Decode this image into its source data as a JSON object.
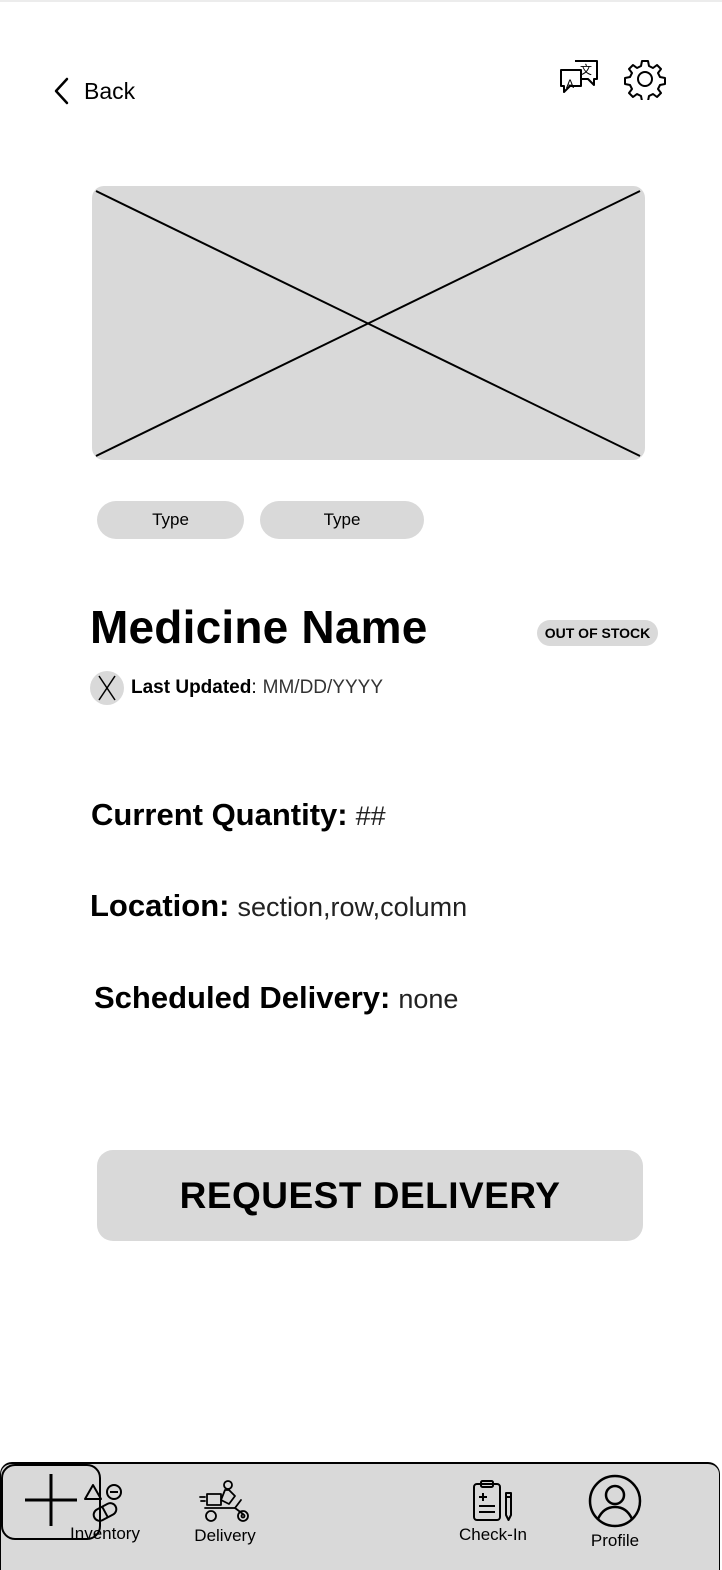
{
  "header": {
    "back_label": "Back",
    "icons": [
      "chevron-left-icon",
      "translate-icon",
      "gear-icon"
    ]
  },
  "product": {
    "types": [
      "Type",
      "Type"
    ],
    "name": "Medicine Name",
    "stock_badge": "OUT OF STOCK",
    "last_updated_label": "Last Updated",
    "last_updated_colon": ":",
    "last_updated_value": "MM/DD/YYYY"
  },
  "details": {
    "quantity_label": "Current Quantity:",
    "quantity_value": "##",
    "location_label": "Location:",
    "location_value": "section,row,column",
    "delivery_label": "Scheduled Delivery:",
    "delivery_value": "none"
  },
  "actions": {
    "request_label": "REQUEST DELIVERY"
  },
  "nav": {
    "inventory": "Inventory",
    "delivery": "Delivery",
    "checkin": "Check-In",
    "profile": "Profile"
  },
  "colors": {
    "placeholder": "#d9d9d9",
    "background": "#ffffff",
    "text": "#000000"
  }
}
